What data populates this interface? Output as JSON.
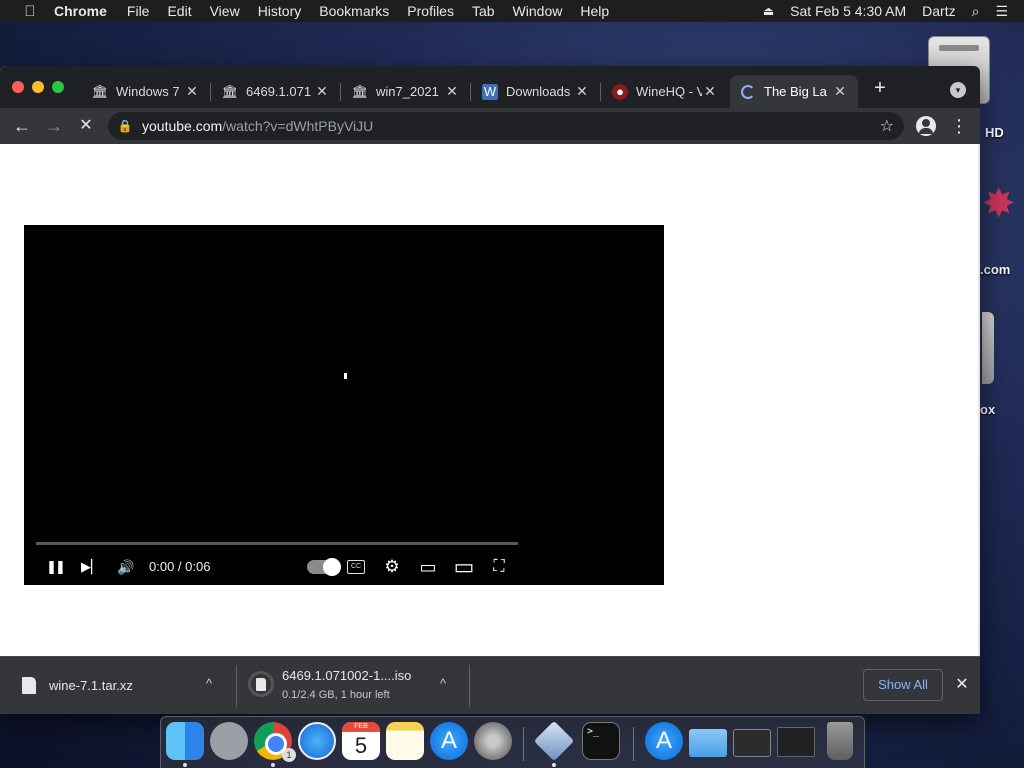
{
  "menubar": {
    "apple_icon": "apple-icon",
    "app_name": "Chrome",
    "items": [
      "File",
      "Edit",
      "View",
      "History",
      "Bookmarks",
      "Profiles",
      "Tab",
      "Window",
      "Help"
    ],
    "eject_glyph": "⏏",
    "datetime": "Sat Feb 5  4:30 AM",
    "user": "Dartz",
    "search_glyph": "⌕",
    "list_glyph": "☰"
  },
  "desktop": {
    "labels": [
      "HD",
      ".com",
      "ox"
    ]
  },
  "tabs": [
    {
      "title": "Windows 7",
      "favicon": "museum-icon"
    },
    {
      "title": "6469.1.071",
      "favicon": "museum-icon"
    },
    {
      "title": "win7_2021",
      "favicon": "museum-icon"
    },
    {
      "title": "Downloads",
      "favicon": "downloads-icon"
    },
    {
      "title": "WineHQ - V",
      "favicon": "wine-icon"
    },
    {
      "title": "The Big La",
      "favicon": "loading-icon"
    }
  ],
  "tab_close_glyph": "✕",
  "new_tab_glyph": "+",
  "tab_search_glyph": "▾",
  "toolbar": {
    "back_glyph": "←",
    "forward_glyph": "→",
    "stop_glyph": "✕",
    "lock_glyph": "🔒",
    "url_host": "youtube.com",
    "url_path": "/watch?v=dWhtPByViJU",
    "star_glyph": "☆",
    "menu_glyph": "⋮"
  },
  "player": {
    "time": "0:00 / 0:06",
    "progress": 0,
    "pause_glyph": "❚❚",
    "next_glyph": "▶▏",
    "volume_glyph": "🔊",
    "settings_glyph": "⚙",
    "cc_text": "CC",
    "miniplayer_glyph": "▭",
    "theater_glyph": "▭",
    "fullscreen_glyph": "⛶"
  },
  "downloads": [
    {
      "name": "wine-7.1.tar.xz",
      "status": ""
    },
    {
      "name": "6469.1.071002-1....iso",
      "status": "0.1/2.4 GB, 1 hour left"
    }
  ],
  "caret_glyph": "^",
  "show_all": "Show All",
  "shelf_close_glyph": "✕",
  "dock": {
    "calendar_month": "FEB",
    "calendar_day": "5",
    "chrome_badge": "1",
    "terminal_prompt": ">_",
    "appstore_glyph": "A"
  },
  "colors": {
    "chrome_dark": "#202124",
    "toolbar": "#35363a",
    "link_blue": "#8ab4f8",
    "progress_red": "#ff0000"
  }
}
